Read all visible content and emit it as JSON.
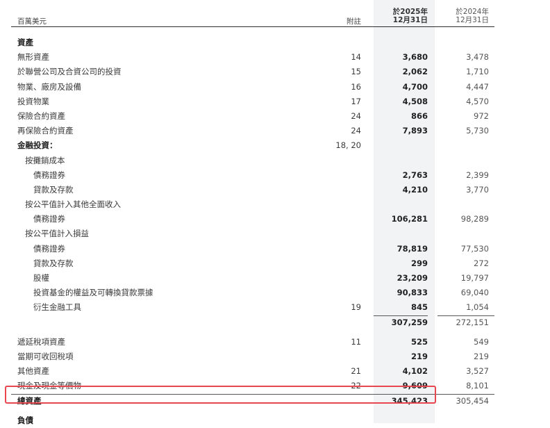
{
  "header": {
    "unit_label": "百萬美元",
    "note_label": "附註",
    "current_col_line1": "於2025年",
    "current_col_line2": "12月31日",
    "prior_col_line1": "於2024年",
    "prior_col_line2": "12月31日"
  },
  "rows_a": [
    {
      "label": "資產",
      "note": "",
      "current": "",
      "prior": "",
      "style": "bold",
      "indent": 0
    },
    {
      "label": "無形資產",
      "note": "14",
      "current": "3,680",
      "prior": "3,478",
      "style": "",
      "indent": 0
    },
    {
      "label": "於聯營公司及合資公司的投資",
      "note": "15",
      "current": "2,062",
      "prior": "1,710",
      "style": "",
      "indent": 0
    },
    {
      "label": "物業、廠房及設備",
      "note": "16",
      "current": "4,700",
      "prior": "4,447",
      "style": "",
      "indent": 0
    },
    {
      "label": "投資物業",
      "note": "17",
      "current": "4,508",
      "prior": "4,570",
      "style": "",
      "indent": 0
    },
    {
      "label": "保險合約資產",
      "note": "24",
      "current": "866",
      "prior": "972",
      "style": "",
      "indent": 0
    },
    {
      "label": "再保險合約資產",
      "note": "24",
      "current": "7,893",
      "prior": "5,730",
      "style": "",
      "indent": 0
    },
    {
      "label": "金融投資：",
      "note": "18, 20",
      "current": "",
      "prior": "",
      "style": "bold",
      "indent": 0
    },
    {
      "label": "按攤銷成本",
      "note": "",
      "current": "",
      "prior": "",
      "style": "",
      "indent": 1
    },
    {
      "label": "債務證券",
      "note": "",
      "current": "2,763",
      "prior": "2,399",
      "style": "",
      "indent": 2
    },
    {
      "label": "貸款及存款",
      "note": "",
      "current": "4,210",
      "prior": "3,770",
      "style": "",
      "indent": 2
    },
    {
      "label": "按公平值計入其他全面收入",
      "note": "",
      "current": "",
      "prior": "",
      "style": "",
      "indent": 1
    },
    {
      "label": "債務證券",
      "note": "",
      "current": "106,281",
      "prior": "98,289",
      "style": "",
      "indent": 2
    },
    {
      "label": "按公平值計入損益",
      "note": "",
      "current": "",
      "prior": "",
      "style": "",
      "indent": 1
    },
    {
      "label": "債務證券",
      "note": "",
      "current": "78,819",
      "prior": "77,530",
      "style": "",
      "indent": 2
    },
    {
      "label": "貸款及存款",
      "note": "",
      "current": "299",
      "prior": "272",
      "style": "",
      "indent": 2
    },
    {
      "label": "股權",
      "note": "",
      "current": "23,209",
      "prior": "19,797",
      "style": "",
      "indent": 2
    },
    {
      "label": "投資基金的權益及可轉換貸款票據",
      "note": "",
      "current": "90,833",
      "prior": "69,040",
      "style": "",
      "indent": 2
    },
    {
      "label": "衍生金融工具",
      "note": "19",
      "current": "845",
      "prior": "1,054",
      "style": "",
      "indent": 2
    }
  ],
  "subtotal": {
    "current": "307,259",
    "prior": "272,151"
  },
  "rows_b": [
    {
      "label": "遞延稅項資產",
      "note": "11",
      "current": "525",
      "prior": "549",
      "style": "",
      "indent": 0
    },
    {
      "label": "當期可收回稅項",
      "note": "",
      "current": "219",
      "prior": "219",
      "style": "",
      "indent": 0
    },
    {
      "label": "其他資產",
      "note": "21",
      "current": "4,102",
      "prior": "3,527",
      "style": "",
      "indent": 0
    },
    {
      "label": "現金及現金等價物",
      "note": "22",
      "current": "9,609",
      "prior": "8,101",
      "style": "",
      "indent": 0
    }
  ],
  "total": {
    "label": "總資產",
    "current": "345,423",
    "prior": "305,454"
  },
  "liabilities_heading": "負債"
}
